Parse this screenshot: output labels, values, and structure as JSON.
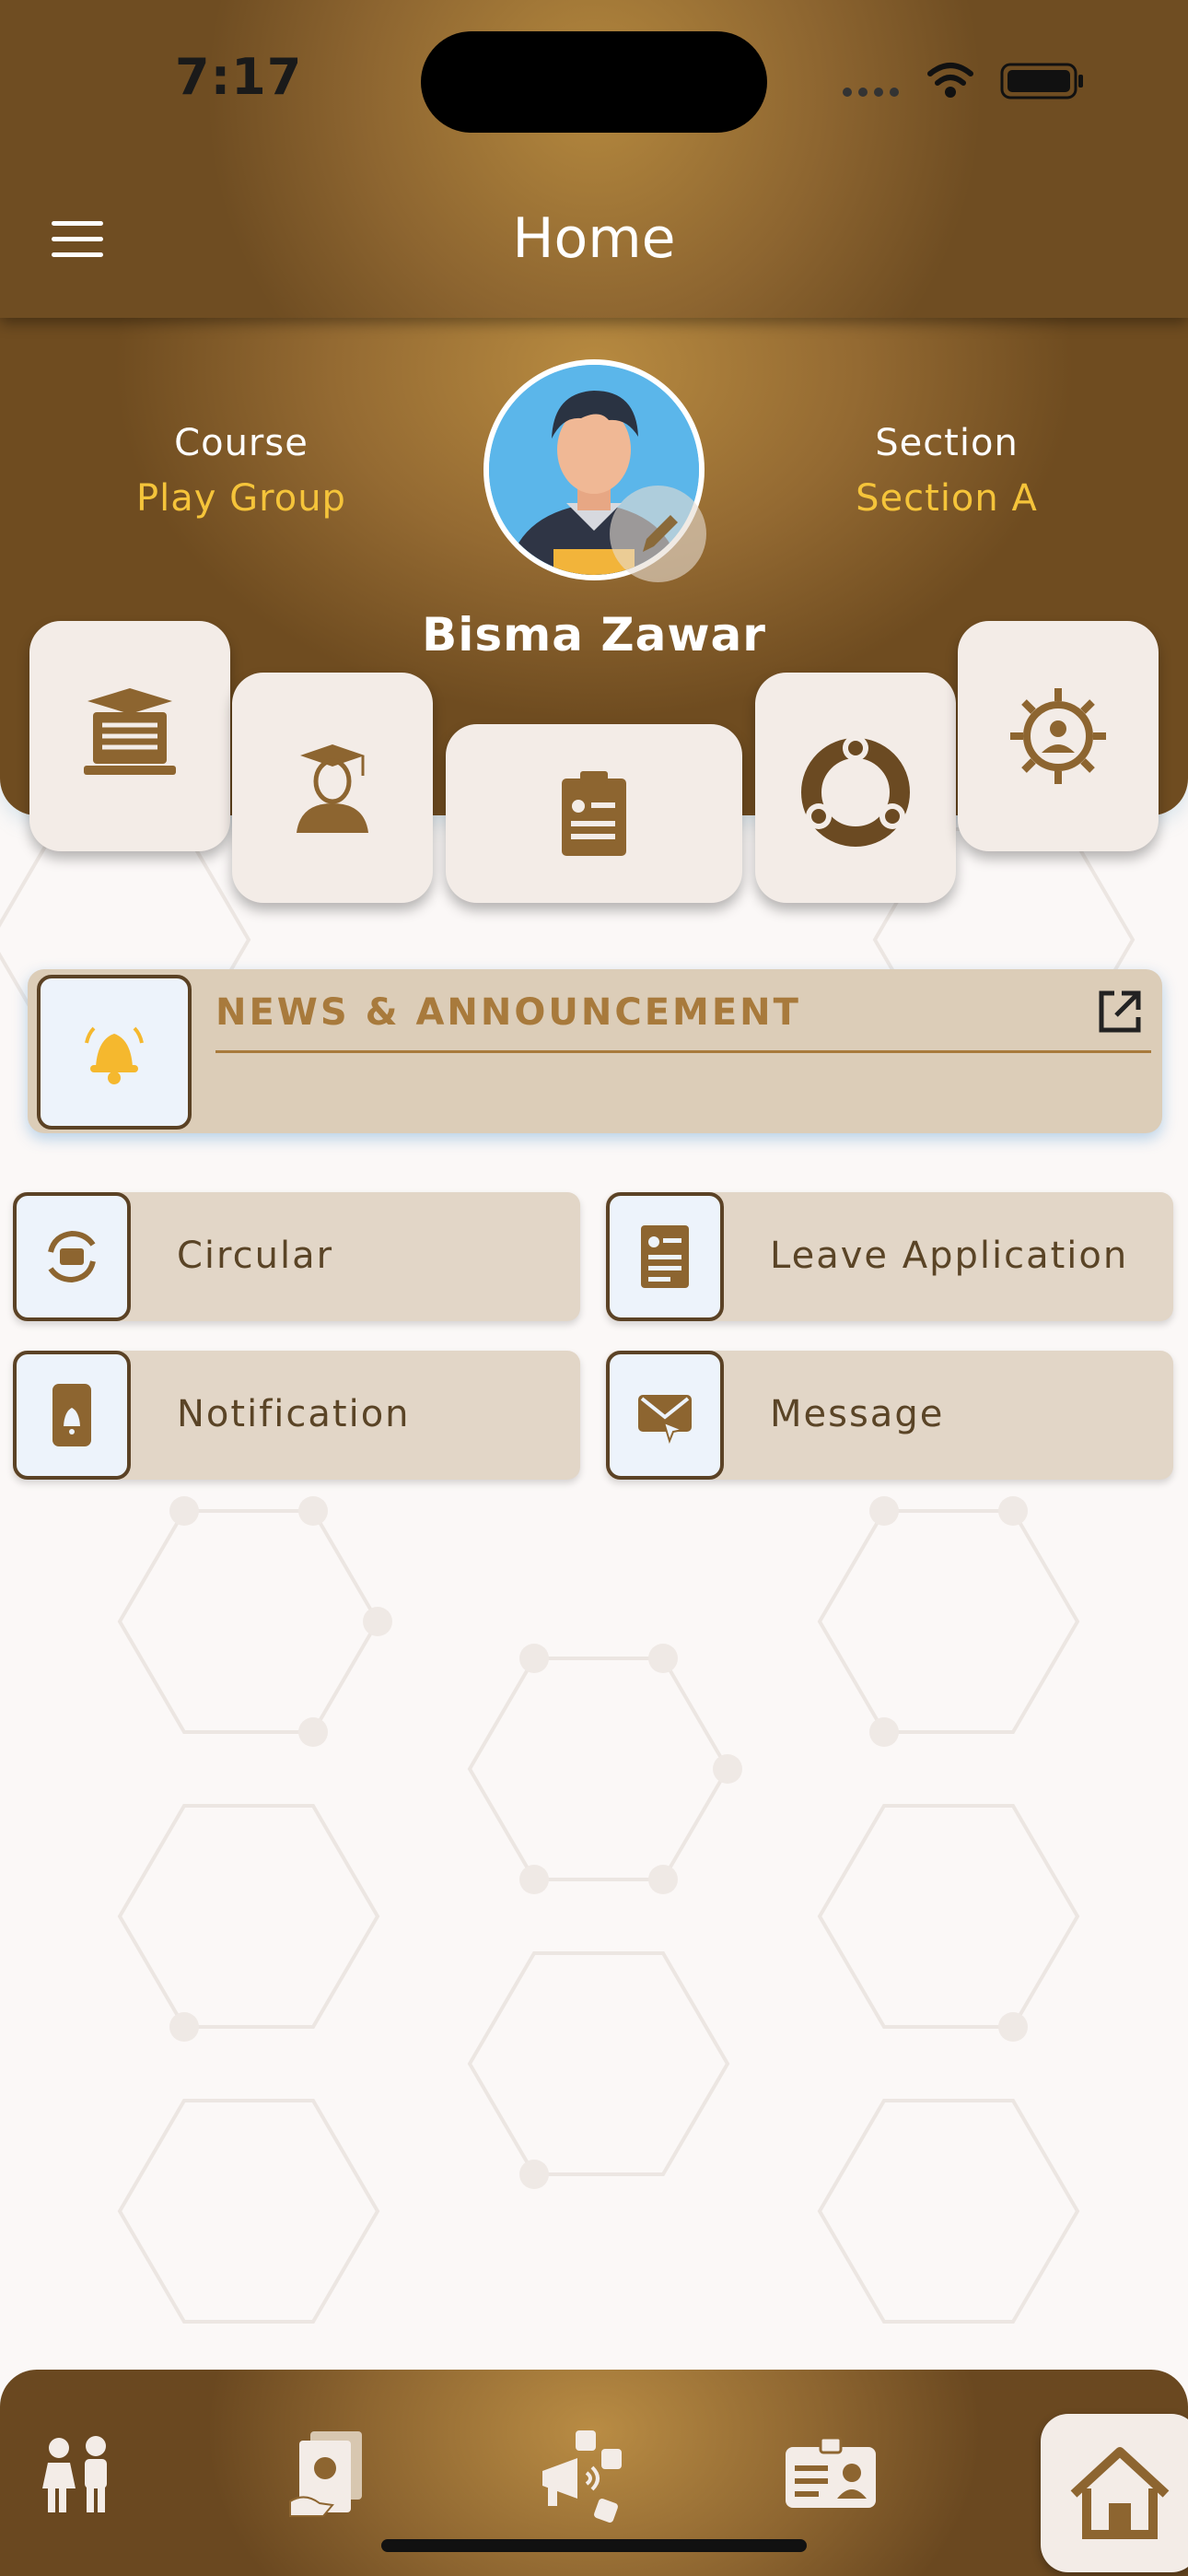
{
  "status_bar": {
    "time": "7:17"
  },
  "header": {
    "title": "Home"
  },
  "profile": {
    "course_label": "Course",
    "course_value": "Play Group",
    "section_label": "Section",
    "section_value": "Section A",
    "student_name": "Bisma Zawar"
  },
  "quick_tiles": [
    {
      "icon": "classroom-board-icon"
    },
    {
      "icon": "graduate-icon"
    },
    {
      "icon": "report-card-icon"
    },
    {
      "icon": "community-icon"
    },
    {
      "icon": "settings-gear-icon"
    }
  ],
  "news": {
    "title": "NEWS & ANNOUNCEMENT",
    "icon": "bell-icon",
    "action_icon": "external-link-icon"
  },
  "cards": [
    {
      "label": "Circular",
      "icon": "circular-icon"
    },
    {
      "label": "Leave Application",
      "icon": "leave-application-icon"
    },
    {
      "label": "Notification",
      "icon": "notification-phone-icon"
    },
    {
      "label": "Message",
      "icon": "message-envelope-icon"
    }
  ],
  "bottom_nav": [
    {
      "icon": "family-icon"
    },
    {
      "icon": "fee-documents-icon"
    },
    {
      "icon": "social-megaphone-icon"
    },
    {
      "icon": "id-card-icon"
    },
    {
      "icon": "home-icon",
      "active": true
    }
  ],
  "colors": {
    "accent": "#a87a3c",
    "brand": "#8d6530",
    "highlight": "#f5c43a",
    "tile_bg": "#f3ece7",
    "card_bg": "#e2d6c7"
  }
}
